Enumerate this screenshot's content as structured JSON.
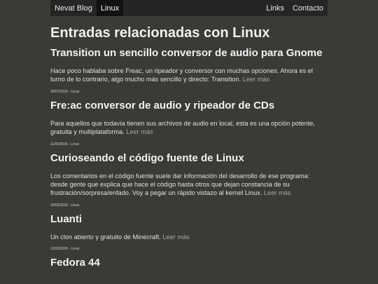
{
  "nav": {
    "brand": "Nevat Blog",
    "active_tab": "Linux",
    "links": "Links",
    "contact": "Contacto"
  },
  "page_title": "Entradas relacionadas con Linux",
  "posts": [
    {
      "title": "Transition un sencillo conversor de audio para Gnome",
      "excerpt": "Hace poco hablaba sobre Freac, un ripeador y conversor con muchas opciones. Ahora es el turno de lo contrario, algo mucho más sencillo y directo: Transition.",
      "read_more": "Leer más",
      "meta": "30/07/2026 - Linux"
    },
    {
      "title": "Fre:ac conversor de audio y ripeador de CDs",
      "excerpt": "Para aquellos que todavía tienen sus archivos de audio en local, esta es una opción potente, gratuita y multiplataforma.",
      "read_more": "Leer más",
      "meta": "11/06/2026 - Linux"
    },
    {
      "title": "Curioseando el código fuente de Linux",
      "excerpt": "Los comentarios en el código fuente suele dar información del desarrollo de ese programa: desde gente que explica que hace el código hasta otros que dejan constancia de su frustración/sorpresa/enfado. Voy a pegar un rápido vistazo al kernel Linux.",
      "read_more": "Leer más",
      "meta": "18/05/2026 - Linux"
    },
    {
      "title": "Luanti",
      "excerpt": "Un clon abierto y gratuito de Minecraft.",
      "read_more": "Leer más",
      "meta": "12/05/2026 - Linux"
    },
    {
      "title": "Fedora 44"
    }
  ]
}
